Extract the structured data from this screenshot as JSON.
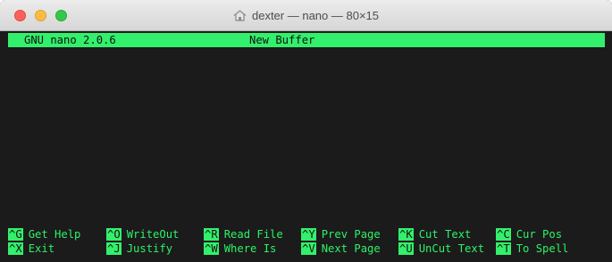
{
  "window": {
    "title": "dexter — nano — 80×15",
    "title_icon": "home-icon"
  },
  "nano": {
    "version": "GNU nano 2.0.6",
    "buffer": "New Buffer"
  },
  "shortcuts": {
    "row1": [
      {
        "key": "^G",
        "label": "Get Help"
      },
      {
        "key": "^O",
        "label": "WriteOut"
      },
      {
        "key": "^R",
        "label": "Read File"
      },
      {
        "key": "^Y",
        "label": "Prev Page"
      },
      {
        "key": "^K",
        "label": "Cut Text"
      },
      {
        "key": "^C",
        "label": "Cur Pos"
      }
    ],
    "row2": [
      {
        "key": "^X",
        "label": "Exit"
      },
      {
        "key": "^J",
        "label": "Justify"
      },
      {
        "key": "^W",
        "label": "Where Is"
      },
      {
        "key": "^V",
        "label": "Next Page"
      },
      {
        "key": "^U",
        "label": "UnCut Text"
      },
      {
        "key": "^T",
        "label": "To Spell"
      }
    ]
  },
  "colors": {
    "terminal_bg": "#1b1b1b",
    "accent_green": "#33f06c"
  }
}
